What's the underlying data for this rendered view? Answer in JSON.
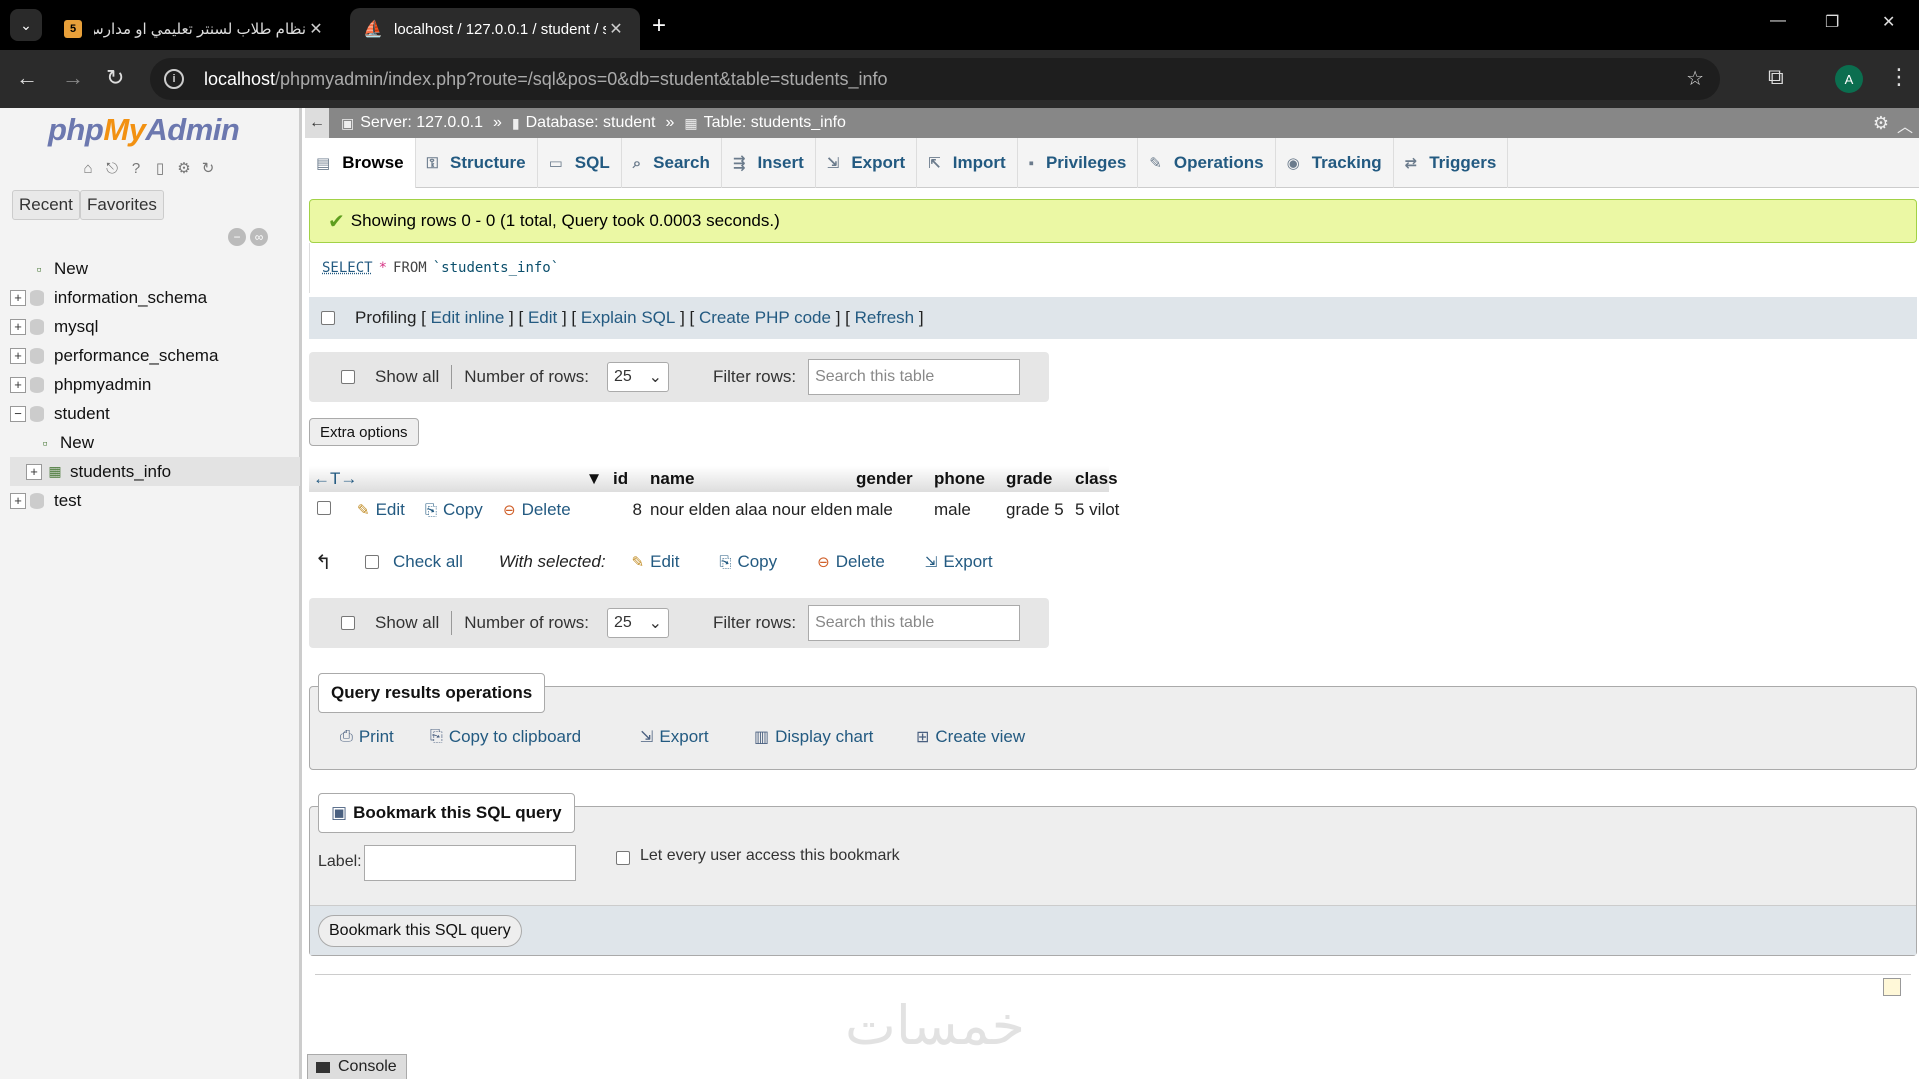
{
  "browser": {
    "tabs": [
      {
        "title": "نظام طلاب لسنتر تعليمي او مدارس",
        "active": false,
        "favicon_label": "5"
      },
      {
        "title": "localhost / 127.0.0.1 / student / s",
        "active": true
      }
    ],
    "url_host": "localhost",
    "url_path": "/phpmyadmin/index.php?route=/sql&pos=0&db=student&table=students_info",
    "avatar_letter": "A"
  },
  "sidebar": {
    "logo_php": "php",
    "logo_my": "My",
    "logo_admin": "Admin",
    "recent_label": "Recent",
    "favorites_label": "Favorites",
    "tree": [
      {
        "label": "New",
        "type": "new"
      },
      {
        "label": "information_schema",
        "type": "db"
      },
      {
        "label": "mysql",
        "type": "db"
      },
      {
        "label": "performance_schema",
        "type": "db"
      },
      {
        "label": "phpmyadmin",
        "type": "db"
      },
      {
        "label": "student",
        "type": "db-open"
      },
      {
        "label": "New",
        "type": "child-new"
      },
      {
        "label": "students_info",
        "type": "child-table"
      },
      {
        "label": "test",
        "type": "db"
      }
    ]
  },
  "breadcrumb": {
    "server": "Server: 127.0.0.1",
    "database": "Database: student",
    "table": "Table: students_info"
  },
  "tabs": [
    {
      "label": "Browse",
      "icon": "browse-icon"
    },
    {
      "label": "Structure",
      "icon": "structure-icon"
    },
    {
      "label": "SQL",
      "icon": "sql-icon"
    },
    {
      "label": "Search",
      "icon": "search-icon"
    },
    {
      "label": "Insert",
      "icon": "insert-icon"
    },
    {
      "label": "Export",
      "icon": "export-icon"
    },
    {
      "label": "Import",
      "icon": "import-icon"
    },
    {
      "label": "Privileges",
      "icon": "privileges-icon"
    },
    {
      "label": "Operations",
      "icon": "wrench-icon"
    },
    {
      "label": "Tracking",
      "icon": "eye-icon"
    },
    {
      "label": "Triggers",
      "icon": "triggers-icon"
    }
  ],
  "message": "Showing rows 0 - 0 (1 total, Query took 0.0003 seconds.)",
  "sql": {
    "select": "SELECT",
    "star": "*",
    "from": "FROM",
    "table": "`students_info`"
  },
  "profiling": {
    "label": "Profiling",
    "links": [
      "Edit inline",
      "Edit",
      "Explain SQL",
      "Create PHP code",
      "Refresh"
    ]
  },
  "nav": {
    "show_all": "Show all",
    "rows_label": "Number of rows:",
    "rows_value": "25",
    "filter_label": "Filter rows:",
    "filter_placeholder": "Search this table"
  },
  "extra_options": "Extra options",
  "table": {
    "columns": [
      "id",
      "name",
      "gender",
      "phone",
      "grade",
      "class"
    ],
    "rows": [
      {
        "id": "8",
        "name": "nour elden alaa nour elden",
        "gender": "male",
        "phone": "male",
        "grade": "grade 5",
        "class": "5 vilot"
      }
    ],
    "row_actions": {
      "edit": "Edit",
      "copy": "Copy",
      "delete": "Delete"
    }
  },
  "with_selected": {
    "check_all": "Check all",
    "label": "With selected:",
    "edit": "Edit",
    "copy": "Copy",
    "delete": "Delete",
    "export": "Export"
  },
  "query_ops": {
    "legend": "Query results operations",
    "print": "Print",
    "copy": "Copy to clipboard",
    "export": "Export",
    "chart": "Display chart",
    "view": "Create view"
  },
  "bookmark": {
    "legend": "Bookmark this SQL query",
    "label": "Label:",
    "every_user": "Let every user access this bookmark",
    "button": "Bookmark this SQL query"
  },
  "console": "Console",
  "watermark": "خمسات"
}
